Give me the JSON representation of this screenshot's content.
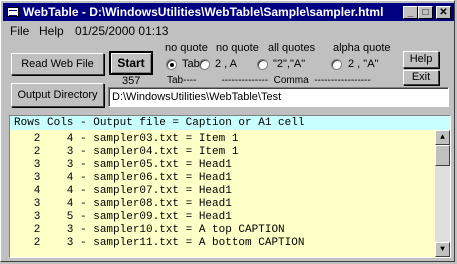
{
  "window": {
    "title": "WebTable - D:\\WindowsUtilities\\WebTable\\Sample\\sampler.html"
  },
  "titlebar_buttons": {
    "minimize": "_",
    "maximize": "□",
    "close": "✕"
  },
  "menu": {
    "file": "File",
    "help": "Help",
    "date": "01/25/2000 01:13"
  },
  "buttons": {
    "read": "Read Web File",
    "start": "Start",
    "output_dir": "Output Directory",
    "help": "Help",
    "exit": "Exit"
  },
  "count": "357",
  "options": {
    "headers": [
      "no quote",
      "no quote",
      "all quotes",
      "alpha quote"
    ],
    "items": [
      {
        "label": "Tab",
        "selected": true
      },
      {
        "label": "2 , A",
        "selected": false
      },
      {
        "label": "\"2\",\"A\"",
        "selected": false
      },
      {
        "label": "2 , \"A\"",
        "selected": false
      }
    ],
    "legend": "Tab----         --------------  Comma  -----------------"
  },
  "output_path": "D:\\WindowsUtilities\\WebTable\\Test",
  "list": {
    "header": "Rows Cols - Output file = Caption or A1 cell",
    "rows": [
      "   2    4 - sampler03.txt = Item 1",
      "   2    3 - sampler04.txt = Item 1",
      "   3    3 - sampler05.txt = Head1",
      "   3    4 - sampler06.txt = Head1",
      "   4    4 - sampler07.txt = Head1",
      "   3    4 - sampler08.txt = Head1",
      "   3    5 - sampler09.txt = Head1",
      "   2    3 - sampler10.txt = A top CAPTION",
      "   2    3 - sampler11.txt = A bottom CAPTION"
    ]
  },
  "scroll": {
    "up": "▲",
    "down": "▼"
  }
}
